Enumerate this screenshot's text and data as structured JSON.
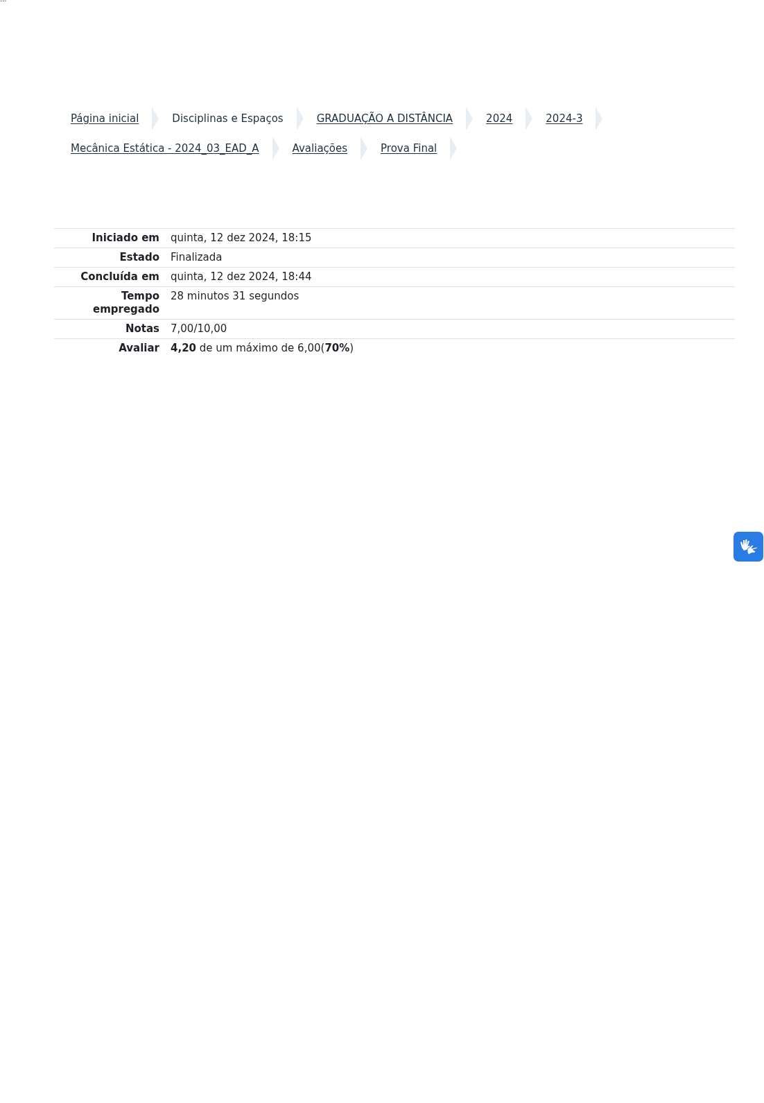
{
  "top_mark": "...",
  "breadcrumb": [
    {
      "label": "Página inicial",
      "link": true
    },
    {
      "label": "Disciplinas e Espaços",
      "link": false
    },
    {
      "label": "GRADUAÇÃO A DISTÂNCIA",
      "link": true
    },
    {
      "label": "2024",
      "link": true
    },
    {
      "label": "2024-3",
      "link": true
    },
    {
      "label": "Mecânica Estática - 2024_03_EAD_A",
      "link": true
    },
    {
      "label": "Avaliações",
      "link": true
    },
    {
      "label": "Prova Final",
      "link": true
    }
  ],
  "summary": [
    {
      "label": "Iniciado em",
      "value": "quinta, 12 dez 2024, 18:15"
    },
    {
      "label": "Estado",
      "value": "Finalizada"
    },
    {
      "label": "Concluída em",
      "value": "quinta, 12 dez 2024, 18:44"
    },
    {
      "label": "Tempo empregado",
      "value": "28 minutos 31 segundos"
    },
    {
      "label": "Notas",
      "value": "7,00/10,00"
    },
    {
      "label": "Avaliar",
      "value": "**4,20** de um máximo de 6,00(**70%**)"
    }
  ]
}
